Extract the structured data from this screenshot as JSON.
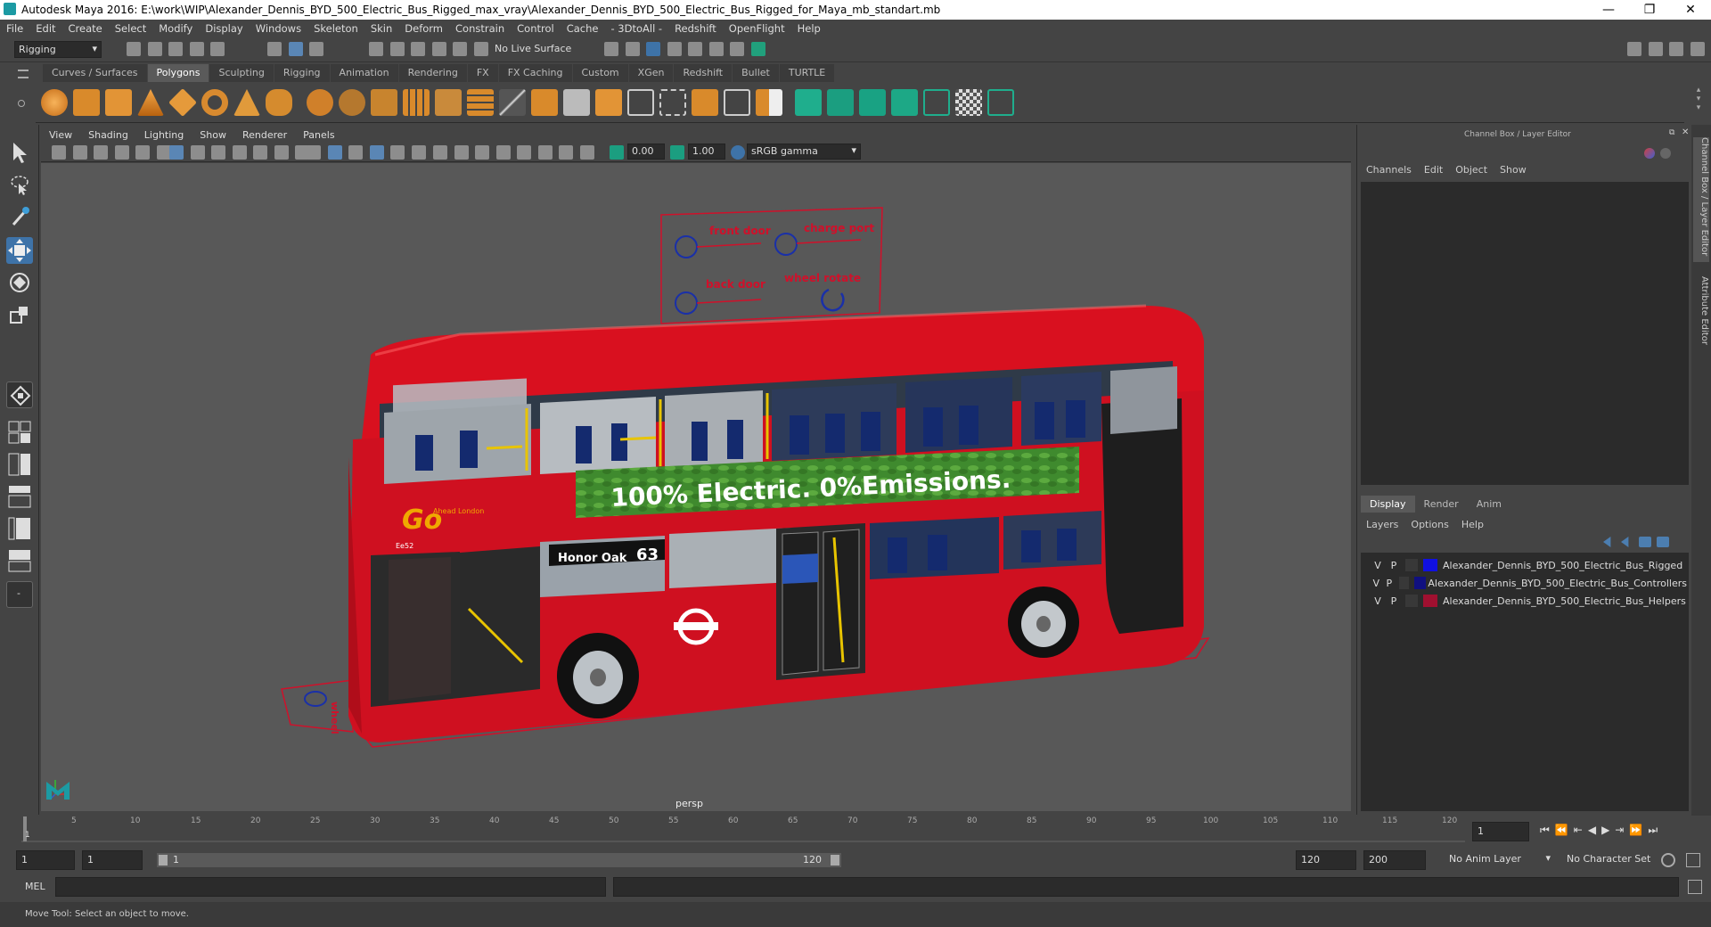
{
  "window": {
    "title": "Autodesk Maya 2016: E:\\work\\WIP\\Alexander_Dennis_BYD_500_Electric_Bus_Rigged_max_vray\\Alexander_Dennis_BYD_500_Electric_Bus_Rigged_for_Maya_mb_standart.mb",
    "minimize": "—",
    "restore": "❐",
    "close": "✕"
  },
  "menu": [
    "File",
    "Edit",
    "Create",
    "Select",
    "Modify",
    "Display",
    "Windows",
    "Skeleton",
    "Skin",
    "Deform",
    "Constrain",
    "Control",
    "Cache",
    "- 3DtoAll -",
    "Redshift",
    "OpenFlight",
    "Help"
  ],
  "status": {
    "mode": "Rigging",
    "live_surface": "No Live Surface"
  },
  "shelf_tabs": [
    "Curves / Surfaces",
    "Polygons",
    "Sculpting",
    "Rigging",
    "Animation",
    "Rendering",
    "FX",
    "FX Caching",
    "Custom",
    "XGen",
    "Redshift",
    "Bullet",
    "TURTLE"
  ],
  "active_shelf": "Polygons",
  "viewport": {
    "menu": [
      "View",
      "Shading",
      "Lighting",
      "Show",
      "Renderer",
      "Panels"
    ],
    "exposure": "0.00",
    "gamma": "1.00",
    "color_space": "sRGB gamma",
    "camera_label": "persp"
  },
  "scene": {
    "controls_panel": [
      "front door",
      "charge port",
      "back door",
      "wheel rotate"
    ],
    "side_label": "wheel",
    "banner": "100% Electric. 0%Emissions.",
    "destination": "Honor Oak",
    "route": "63",
    "fleet_no": "Ee52",
    "brand": "Go",
    "brand_sub": "Ahead London"
  },
  "channel_box": {
    "title": "Channel Box / Layer Editor",
    "menu": [
      "Channels",
      "Edit",
      "Object",
      "Show"
    ]
  },
  "layer_editor": {
    "tabs": [
      "Display",
      "Render",
      "Anim"
    ],
    "active_tab": "Display",
    "menu": [
      "Layers",
      "Options",
      "Help"
    ],
    "layers": [
      {
        "v": "V",
        "p": "P",
        "name": "Alexander_Dennis_BYD_500_Electric_Bus_Rigged",
        "color": "#1010e0"
      },
      {
        "v": "V",
        "p": "P",
        "name": "Alexander_Dennis_BYD_500_Electric_Bus_Controllers",
        "color": "#101080"
      },
      {
        "v": "V",
        "p": "P",
        "name": "Alexander_Dennis_BYD_500_Electric_Bus_Helpers",
        "color": "#a01030"
      }
    ]
  },
  "side_tabs": [
    "Channel Box / Layer Editor",
    "Attribute Editor"
  ],
  "timeline": {
    "ticks": [
      "1",
      "5",
      "10",
      "15",
      "20",
      "25",
      "30",
      "35",
      "40",
      "45",
      "50",
      "55",
      "60",
      "65",
      "70",
      "75",
      "80",
      "85",
      "90",
      "95",
      "100",
      "105",
      "110",
      "115",
      "120"
    ],
    "current_frame": "1"
  },
  "range": {
    "start": "1",
    "playback_start": "1",
    "slider_start": "1",
    "slider_end": "120",
    "playback_end": "120",
    "end": "200",
    "anim_layer": "No Anim Layer",
    "char_set": "No Character Set"
  },
  "mel": {
    "label": "MEL"
  },
  "help_line": "Move Tool: Select an object to move."
}
